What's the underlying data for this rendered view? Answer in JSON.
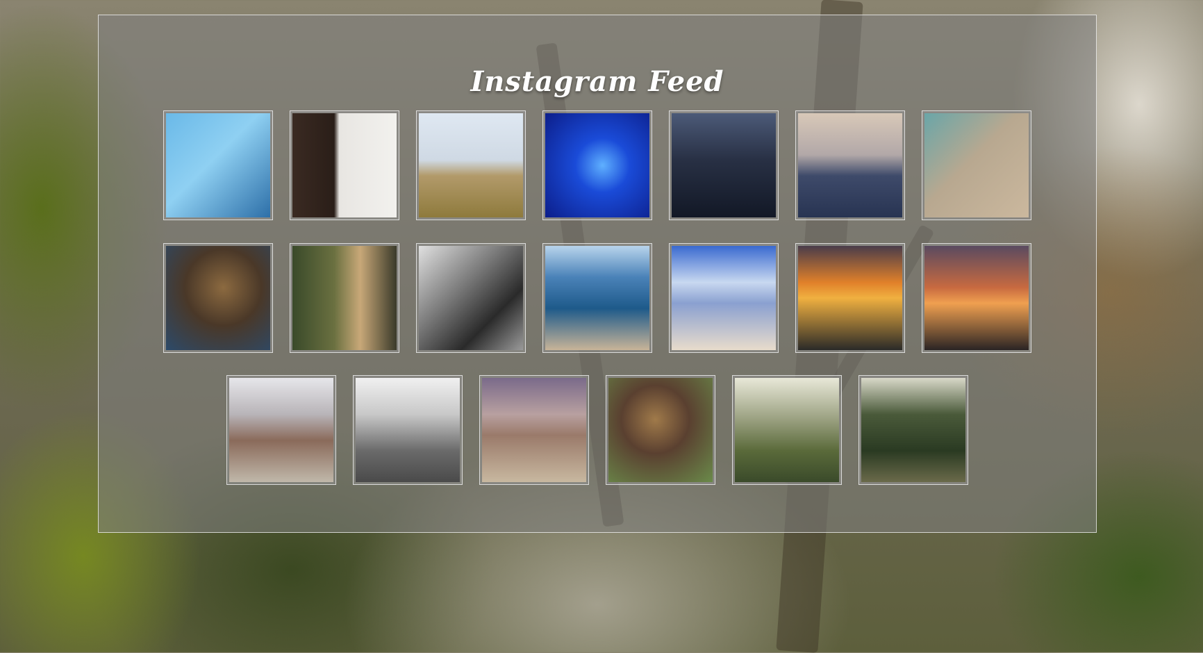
{
  "feed": {
    "title": "Instagram Feed",
    "rows": [
      [
        {
          "name": "photo-history-sign",
          "bg": "linear-gradient(135deg,#6ab9e8 0%,#8fd0f2 45%,#2d6fa8 100%)"
        },
        {
          "name": "photo-gallery-wall",
          "bg": "linear-gradient(90deg,#3a2a22 0%,#2a1e18 40%,#e8e6e2 45%,#f2f1ee 100%)"
        },
        {
          "name": "photo-desert-doorway",
          "bg": "linear-gradient(180deg,#dfe8f2 0%,#cfd9e4 45%,#b29a6a 60%,#8e7a3c 100%)"
        },
        {
          "name": "photo-blue-spiral",
          "bg": "radial-gradient(circle at 55% 50%,#5fb0ff 0%,#1a4bd8 35%,#0c1e8a 100%)"
        },
        {
          "name": "photo-dusk-water",
          "bg": "linear-gradient(180deg,#4c5a78 0%,#283044 45%,#121826 100%)"
        },
        {
          "name": "photo-palm-sunset",
          "bg": "linear-gradient(180deg,#d8c8b8 0%,#b2a8a8 40%,#3e4a6a 60%,#283452 100%)"
        },
        {
          "name": "photo-feet-stone",
          "bg": "linear-gradient(135deg,#6aa6a8 0%,#b8a890 45%,#cbb89e 100%)"
        }
      ],
      [
        {
          "name": "photo-dog-blanket",
          "bg": "radial-gradient(circle at 55% 40%,#8c6a40 0%,#4a3828 45%,#2c4a6a 100%)"
        },
        {
          "name": "photo-wolf-kiss",
          "bg": "linear-gradient(90deg,#3a4a2a 0%,#6a7040 40%,#c8a878 65%,#3a3a2a 100%)"
        },
        {
          "name": "photo-rocks-bw",
          "bg": "linear-gradient(135deg,#e0e0e0 0%,#7a7a7a 40%,#2a2a2a 70%,#9a9a9a 100%)"
        },
        {
          "name": "photo-shoreline",
          "bg": "linear-gradient(180deg,#b8d4ec 0%,#4a82b8 30%,#1e5a8a 60%,#c8b498 100%)"
        },
        {
          "name": "photo-beach-walk",
          "bg": "linear-gradient(180deg,#3a6ad0 0%,#c8d8f0 35%,#8aa0d0 55%,#e8dccc 100%)"
        },
        {
          "name": "photo-fire-sky",
          "bg": "linear-gradient(180deg,#4a3c4a 0%,#e0802a 35%,#f0b040 50%,#2a2a28 100%)"
        },
        {
          "name": "photo-sunset-palms",
          "bg": "linear-gradient(180deg,#5a4a60 0%,#c86a40 40%,#f0a050 55%,#2a2424 100%)"
        }
      ],
      [
        {
          "name": "photo-mountain-clouds",
          "bg": "linear-gradient(180deg,#e6e6ea 0%,#b8b4b8 35%,#8a6a5a 60%,#c0b8aa 100%)"
        },
        {
          "name": "photo-valley-bw",
          "bg": "linear-gradient(180deg,#f0f0f0 0%,#c8c8c8 35%,#6a6a6a 70%,#4a4a4a 100%)"
        },
        {
          "name": "photo-desert-plain",
          "bg": "linear-gradient(180deg,#7a6a8a 0%,#b8a0a0 35%,#9a7a6a 55%,#c8b8a0 100%)"
        },
        {
          "name": "photo-dog-cushion",
          "bg": "radial-gradient(circle at 45% 40%,#a07a4a 0%,#5a4030 40%,#6a8a4a 100%)"
        },
        {
          "name": "photo-sunlit-meadow",
          "bg": "linear-gradient(180deg,#e8e8d8 0%,#9aa080 40%,#5a6a3a 70%,#3a4a2a 100%)"
        },
        {
          "name": "photo-forest-trail",
          "bg": "linear-gradient(180deg,#d8d8c8 0%,#4a5a3a 35%,#2a3a22 70%,#6a6a4a 100%)"
        }
      ]
    ]
  }
}
